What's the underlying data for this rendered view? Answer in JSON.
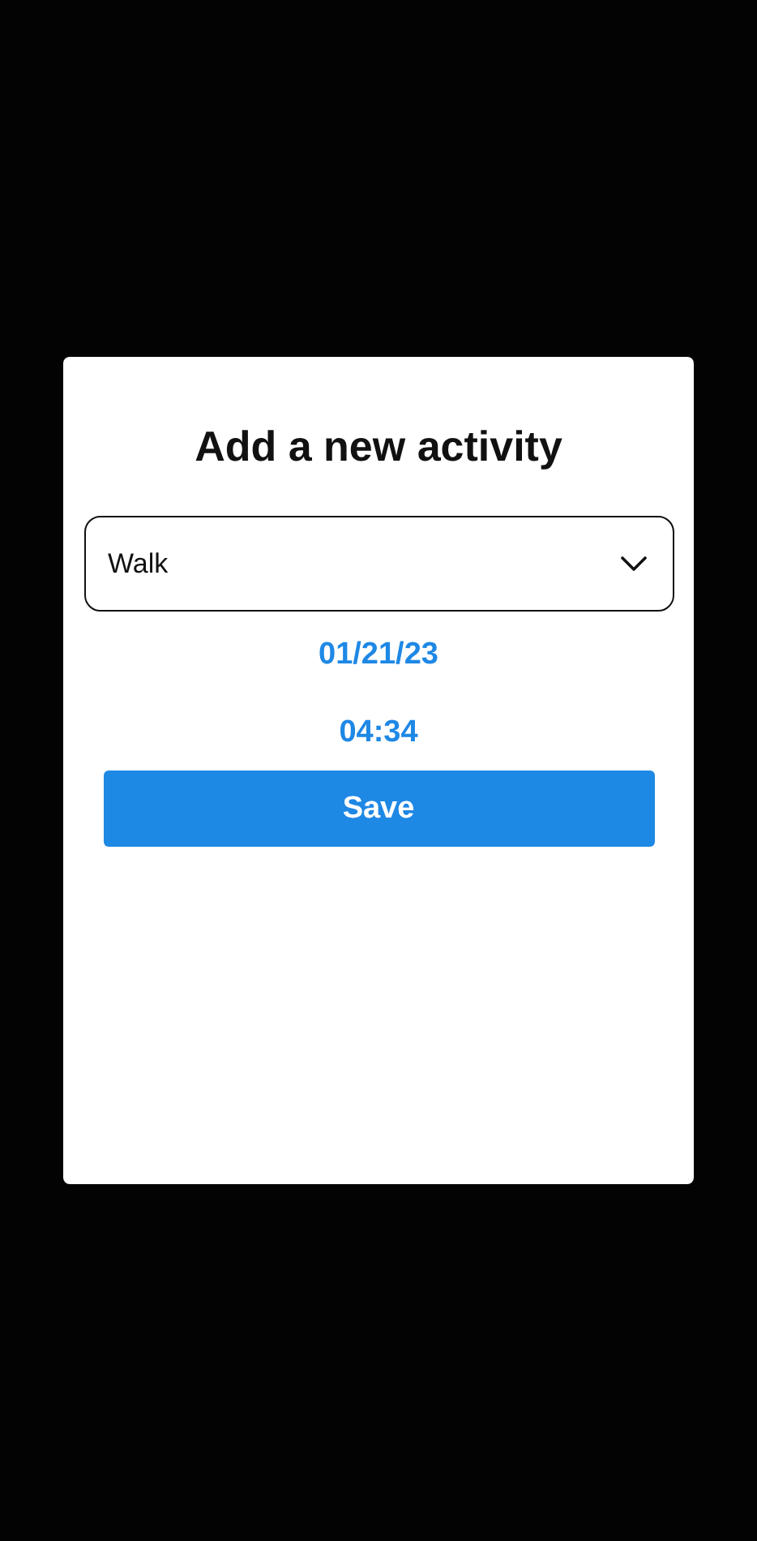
{
  "dialog": {
    "title": "Add a new activity",
    "select": {
      "value": "Walk"
    },
    "date": "01/21/23",
    "time": "04:34",
    "save": "Save"
  }
}
